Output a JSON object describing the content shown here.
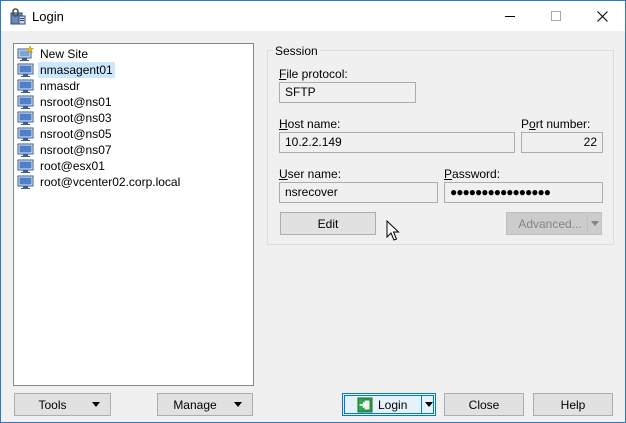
{
  "window": {
    "title": "Login",
    "icons": {
      "app": "winscp-app-icon",
      "minimize": "minimize-icon",
      "maximize": "maximize-icon",
      "close": "close-icon"
    }
  },
  "sites": [
    {
      "label": "New Site",
      "icon": "new-site-icon",
      "selected": false
    },
    {
      "label": "nmasagent01",
      "icon": "computer-icon",
      "selected": true
    },
    {
      "label": "nmasdr",
      "icon": "computer-icon",
      "selected": false
    },
    {
      "label": "nsroot@ns01",
      "icon": "computer-icon",
      "selected": false
    },
    {
      "label": "nsroot@ns03",
      "icon": "computer-icon",
      "selected": false
    },
    {
      "label": "nsroot@ns05",
      "icon": "computer-icon",
      "selected": false
    },
    {
      "label": "nsroot@ns07",
      "icon": "computer-icon",
      "selected": false
    },
    {
      "label": "root@esx01",
      "icon": "computer-icon",
      "selected": false
    },
    {
      "label": "root@vcenter02.corp.local",
      "icon": "computer-icon",
      "selected": false
    }
  ],
  "session": {
    "legend": "Session",
    "file_protocol": {
      "label_accel": "F",
      "label_rest": "ile protocol:",
      "value": "SFTP"
    },
    "host_name": {
      "label_accel": "H",
      "label_rest": "ost name:",
      "value": "10.2.2.149"
    },
    "port_number": {
      "label_pre": "P",
      "label_accel": "o",
      "label_rest": "rt number:",
      "value": "22"
    },
    "user_name": {
      "label_accel": "U",
      "label_rest": "ser name:",
      "value": "nsrecover"
    },
    "password": {
      "label_accel": "P",
      "label_rest": "assword:",
      "value": "●●●●●●●●●●●●●●●●"
    },
    "edit_label": "Edit",
    "advanced_label": "Advanced..."
  },
  "footer": {
    "tools_label": "Tools",
    "manage_label": "Manage",
    "login_label": "Login",
    "close_label": "Close",
    "help_label": "Help"
  },
  "colors": {
    "selection": "#cce8ff",
    "accent": "#0078d7",
    "window_border": "#2b78c5",
    "dialog_bg": "#f0f0f0"
  }
}
